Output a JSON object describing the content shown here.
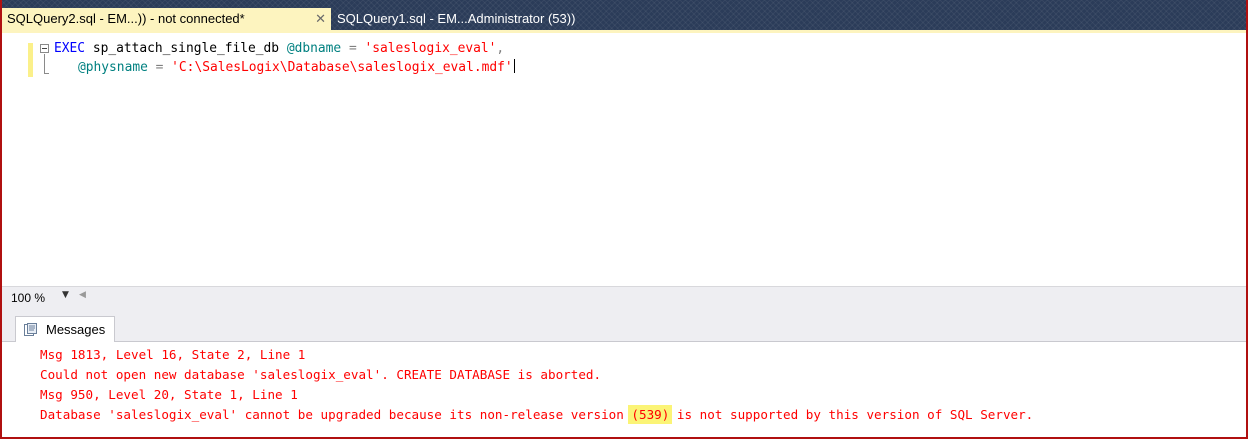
{
  "tabs": [
    {
      "label": "SQLQuery2.sql - EM...)) - not connected*",
      "active": true,
      "close_icon": "close-icon"
    },
    {
      "label": "SQLQuery1.sql - EM...Administrator (53))",
      "active": false
    }
  ],
  "editor": {
    "line1": {
      "keyword": "EXEC",
      "proc": "sp_attach_single_file_db",
      "param": "@dbname",
      "equals": "=",
      "value": "'saleslogix_eval'",
      "comma": ","
    },
    "line2": {
      "param": "@physname",
      "equals": "=",
      "value": "'C:\\SalesLogix\\Database\\saleslogix_eval.mdf'"
    }
  },
  "zoom": {
    "value": "100 %",
    "dropdown_icon": "chevron-down-icon",
    "scroll_icon": "scroll-left-icon"
  },
  "results": {
    "tab_label": "Messages",
    "tab_icon": "messages-icon",
    "lines": {
      "m1": "Msg 1813, Level 16, State 2, Line 1",
      "m2": "Could not open new database 'saleslogix_eval'. CREATE DATABASE is aborted.",
      "m3": "Msg 950, Level 20, State 1, Line 1",
      "m4_pre": "Database 'saleslogix_eval' cannot be upgraded because its non-release version ",
      "m4_highlight": "(539)",
      "m4_post": " is not supported by this version of SQL Server."
    }
  },
  "colors": {
    "tab_strip": "#2b3c59",
    "active_tab": "#fdf4bf",
    "keyword": "#0000ff",
    "variable": "#008080",
    "string": "#ff0000",
    "error_text": "#ff0000",
    "highlight": "#fbf476",
    "frame_border": "#b01010"
  }
}
